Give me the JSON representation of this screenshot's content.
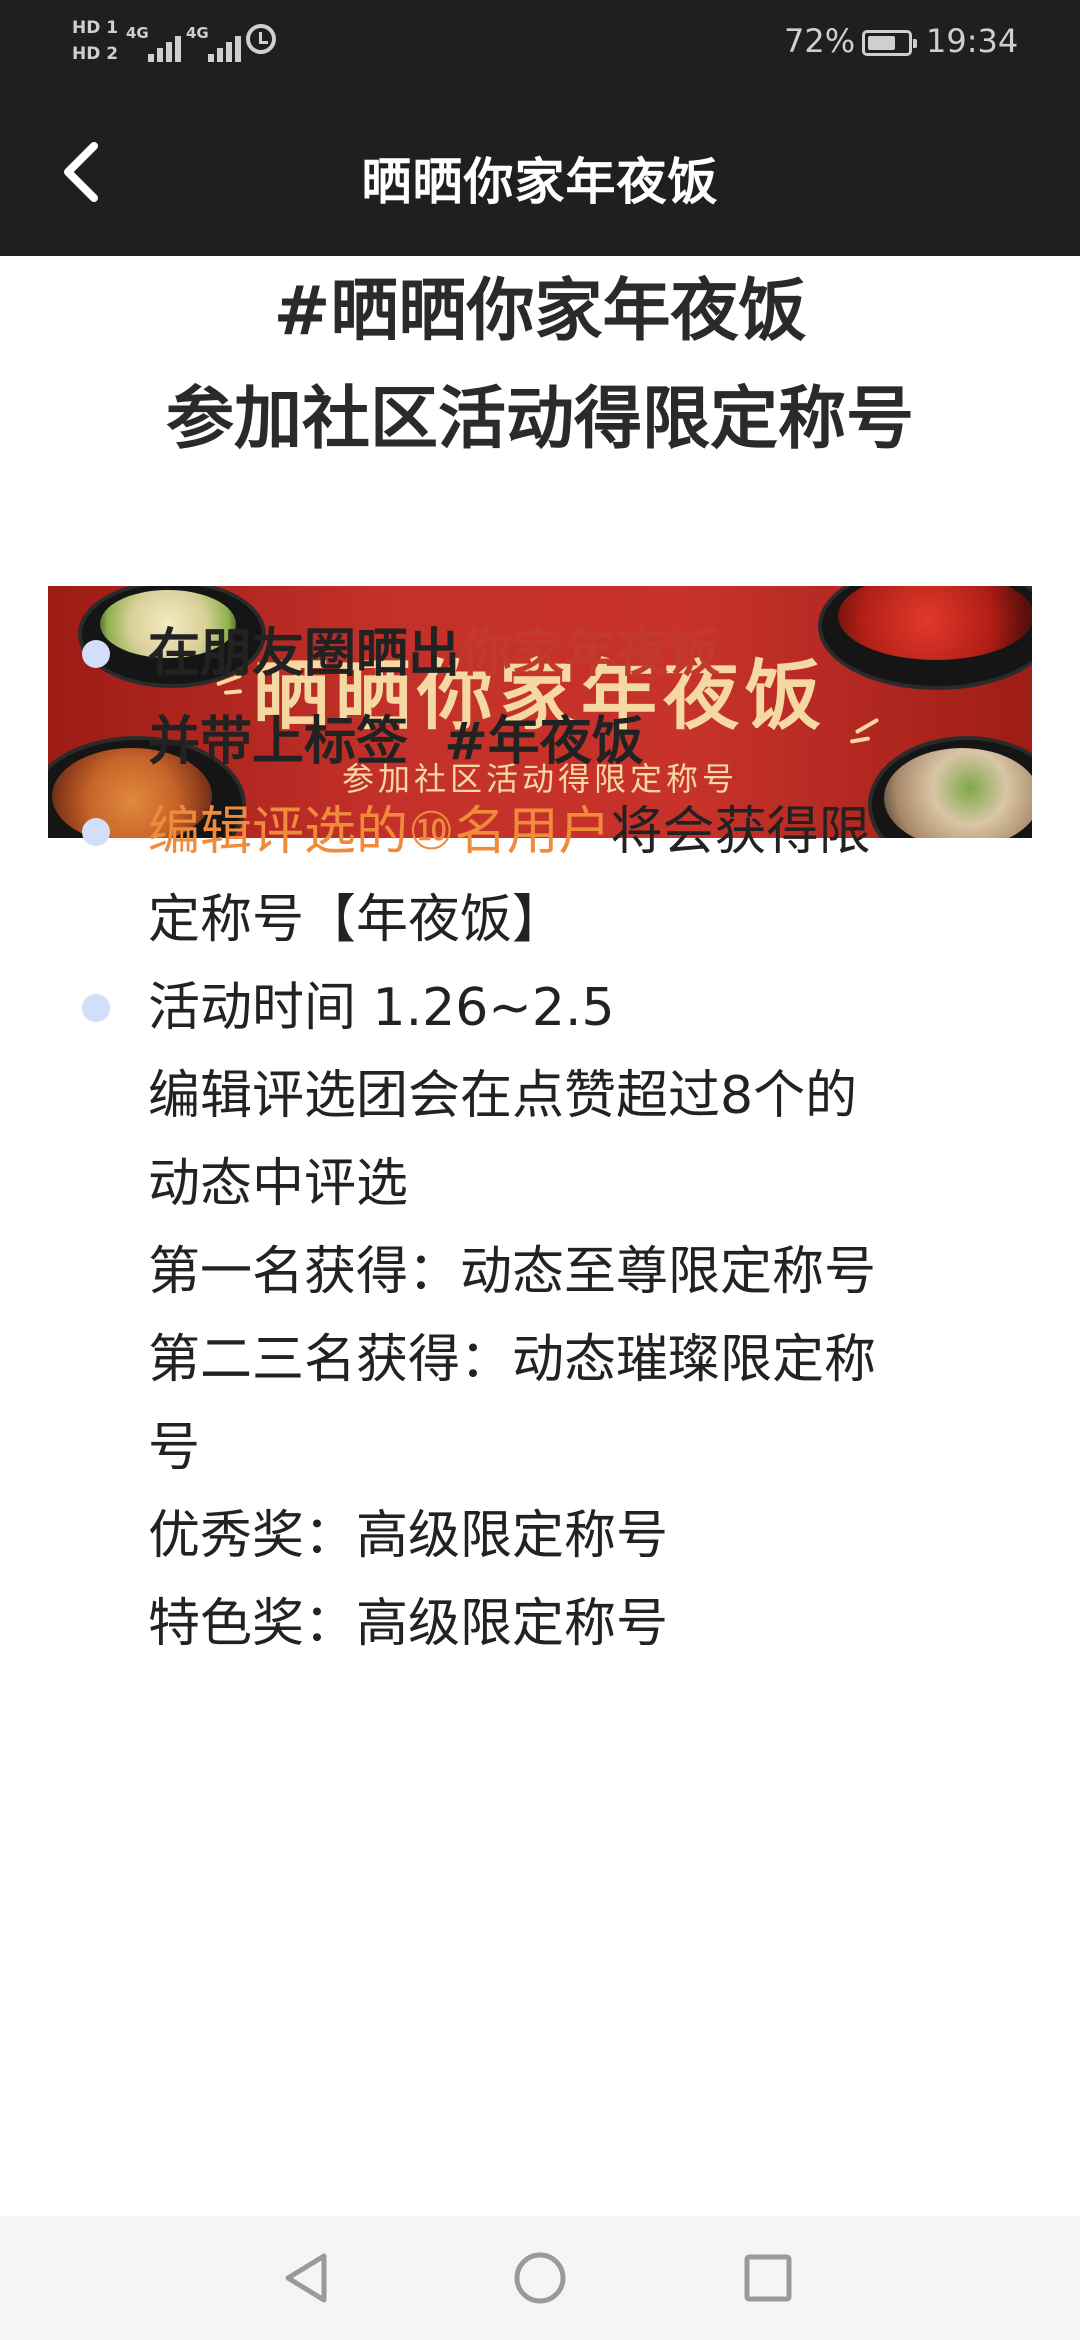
{
  "status_bar": {
    "sim1": "HD 1",
    "sim2": "HD 2",
    "network1": "4G",
    "network2": "4G",
    "battery_percent": "72%",
    "battery_level": 0.72,
    "time": "19:34"
  },
  "header": {
    "title": "晒晒你家年夜饭"
  },
  "hero": {
    "line1": "#晒晒你家年夜饭",
    "line2": "参加社区活动得限定称号"
  },
  "banner": {
    "title": "晒晒你家年夜饭",
    "subtitle": "参加社区活动得限定称号"
  },
  "rules": {
    "item1": {
      "prefix": "在朋友圈晒出",
      "highlight": "你家年夜饭",
      "line2": "并带上标签  #年夜饭"
    },
    "item2": {
      "highlight": "编辑评选的⑩名用户",
      "suffix": "将会获得限",
      "line2": "定称号【年夜饭】"
    },
    "item3": {
      "lines": [
        "活动时间 1.26~2.5",
        "编辑评选团会在点赞超过8个的",
        "动态中评选",
        "第一名获得：动态至尊限定称号",
        "第二三名获得：动态璀璨限定称",
        "号",
        "优秀奖：高级限定称号",
        "特色奖：高级限定称号"
      ]
    }
  },
  "colors": {
    "title_bar": "#1f1f1f",
    "highlight_red": "#c23a2b",
    "highlight_orange": "#ef8b3b",
    "bullet": "#d3defa",
    "banner_red": "#c4312a",
    "banner_text": "#f6d9a2"
  },
  "icons": {
    "back": "chevron-left-icon",
    "nav_back": "triangle-back-icon",
    "nav_home": "circle-home-icon",
    "nav_recent": "square-recent-icon"
  }
}
